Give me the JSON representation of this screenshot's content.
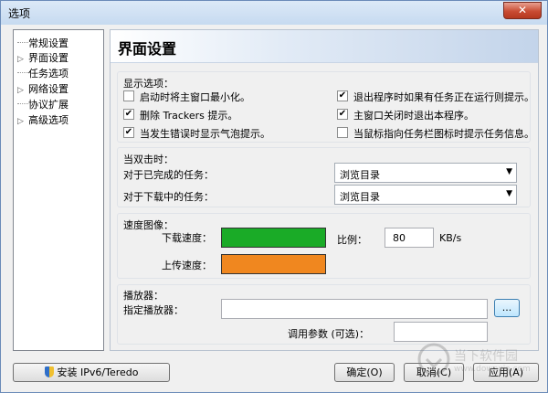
{
  "window": {
    "title": "选项",
    "close_label": "✕"
  },
  "tree": {
    "items": [
      {
        "label": "常规设置",
        "expandable": false
      },
      {
        "label": "界面设置",
        "expandable": true
      },
      {
        "label": "任务选项",
        "expandable": false
      },
      {
        "label": "网络设置",
        "expandable": true
      },
      {
        "label": "协议扩展",
        "expandable": false
      },
      {
        "label": "高级选项",
        "expandable": true
      }
    ]
  },
  "panel": {
    "title": "界面设置"
  },
  "display_options": {
    "heading": "显示选项：",
    "left": [
      {
        "label": "启动时将主窗口最小化。",
        "checked": false
      },
      {
        "label": "删除 Trackers 提示。",
        "checked": true
      },
      {
        "label": "当发生错误时显示气泡提示。",
        "checked": true
      }
    ],
    "right": [
      {
        "label": "退出程序时如果有任务正在运行则提示。",
        "checked": true
      },
      {
        "label": "主窗口关闭时退出本程序。",
        "checked": true
      },
      {
        "label": "当鼠标指向任务栏图标时提示任务信息。",
        "checked": false
      }
    ]
  },
  "double_click": {
    "heading": "当双击时：",
    "completed_label": "对于已完成的任务：",
    "completed_value": "浏览目录",
    "downloading_label": "对于下载中的任务：",
    "downloading_value": "浏览目录"
  },
  "speed_graph": {
    "heading": "速度图像：",
    "download_label": "下载速度：",
    "upload_label": "上传速度：",
    "download_color": "#1aab27",
    "upload_color": "#f0871f",
    "scale_label": "比例：",
    "scale_value": "80",
    "scale_unit": "KB/s"
  },
  "player": {
    "heading": "播放器：",
    "player_label": "指定播放器：",
    "player_value": "",
    "browse_label": "...",
    "params_label": "调用参数 (可选)：",
    "params_value": ""
  },
  "footer": {
    "ipv6_label": "安装 IPv6/Teredo",
    "ok_label": "确定(O)",
    "cancel_label": "取消(C)",
    "apply_label": "应用(A)"
  },
  "watermark": {
    "text": "当下软件园",
    "url": "www.downxia.com"
  }
}
